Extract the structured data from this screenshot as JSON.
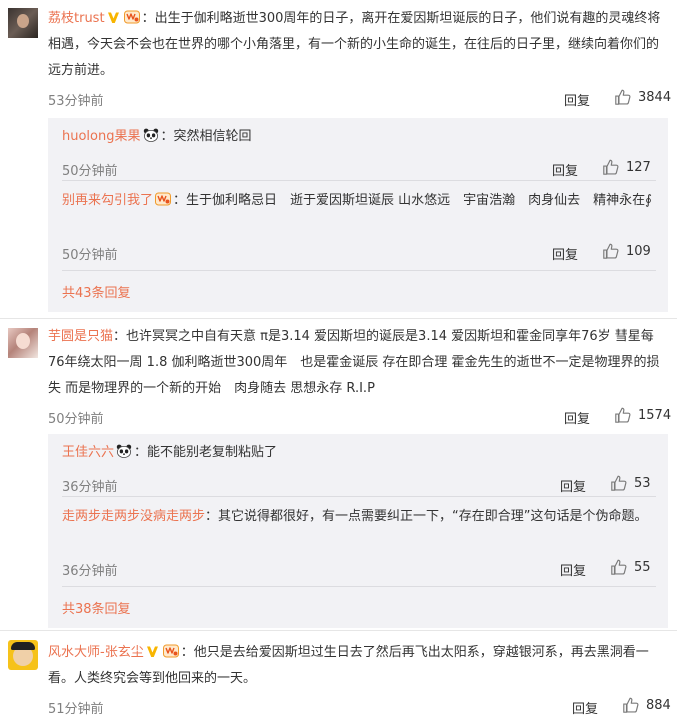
{
  "comments": [
    {
      "username": "荔枝trust",
      "text": "：出生于伽利略逝世300周年的日子，离开在爱因斯坦诞辰的日子，他们说有趣的灵魂终将相遇，今天会不会也在世界的哪个小角落里，有一个新的小生命的诞生，在往后的日子里，继续向着你们的远方前进。",
      "time": "53分钟前",
      "reply_label": "回复",
      "likes": "3844",
      "replies": [
        {
          "username": "huolong果果",
          "text": "：突然相信轮回",
          "time": "50分钟前",
          "reply_label": "回复",
          "likes": "127"
        },
        {
          "username": "别再来勾引我了",
          "text": "：生于伽利略忌日　逝于爱因斯坦诞辰 山水悠远　宇宙浩瀚　肉身仙去　精神永在∮",
          "time": "50分钟前",
          "reply_label": "回复",
          "likes": "109"
        }
      ],
      "more_replies": "共43条回复"
    },
    {
      "username": "芋圆是只猫",
      "text": "：也许冥冥之中自有天意 π是3.14 爱因斯坦的诞辰是3.14 爱因斯坦和霍金同享年76岁 彗星每76年绕太阳一周 1.8 伽利略逝世300周年　也是霍金诞辰 存在即合理 霍金先生的逝世不一定是物理界的损失 而是物理界的一个新的开始　肉身随去 思想永存 R.I.P",
      "time": "50分钟前",
      "reply_label": "回复",
      "likes": "1574",
      "replies": [
        {
          "username": "王佳六六",
          "text": "：能不能别老复制粘贴了",
          "time": "36分钟前",
          "reply_label": "回复",
          "likes": "53"
        },
        {
          "username": "走两步走两步没病走两步",
          "text": "：其它说得都很好，有一点需要纠正一下，“存在即合理”这句话是个伪命题。",
          "time": "36分钟前",
          "reply_label": "回复",
          "likes": "55"
        }
      ],
      "more_replies": "共38条回复"
    },
    {
      "username": "风水大师-张玄尘",
      "text": "：他只是去给爱因斯坦过生日去了然后再飞出太阳系，穿越银河系，再去黑洞看一看。人类终究会等到他回来的一天。",
      "time": "51分钟前",
      "reply_label": "回复",
      "likes": "884"
    }
  ],
  "colors": {
    "username": "#eb7350",
    "meta": "#808080",
    "sub_bg": "#f2f2f5"
  }
}
